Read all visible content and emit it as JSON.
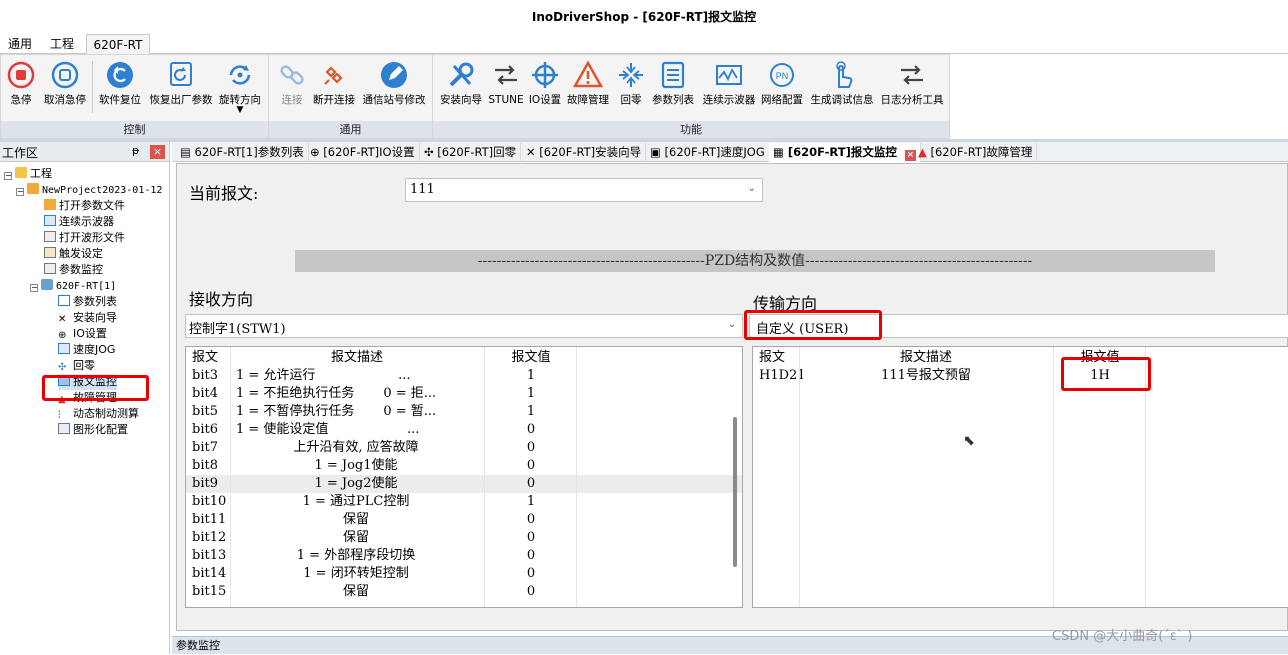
{
  "window": {
    "title": "InoDriverShop - [620F-RT]报文监控"
  },
  "menu_tabs": [
    "通用",
    "工程",
    "620F-RT"
  ],
  "ribbon": {
    "groups": [
      {
        "label": "控制",
        "buttons": [
          "急停",
          "取消急停",
          "软件复位",
          "恢复出厂参数",
          "旋转方向"
        ]
      },
      {
        "label": "通用",
        "buttons": [
          "连接",
          "断开连接",
          "通信站号修改"
        ]
      },
      {
        "label": "功能",
        "buttons": [
          "安装向导",
          "STUNE",
          "IO设置",
          "故障管理",
          "回零",
          "参数列表",
          "连续示波器",
          "网络配置",
          "生成调试信息",
          "日志分析工具"
        ]
      }
    ]
  },
  "workarea": {
    "title": "工作区",
    "pin": "ᵽ",
    "close": "×",
    "tree": [
      "工程",
      "NewProject2023-01-12",
      "打开参数文件",
      "连续示波器",
      "打开波形文件",
      "触发设定",
      "参数监控",
      "620F-RT[1]",
      "参数列表",
      "安装向导",
      "IO设置",
      "速度JOG",
      "回零",
      "报文监控",
      "故障管理",
      "动态制动测算",
      "图形化配置"
    ]
  },
  "doc_tabs": [
    "620F-RT[1]参数列表",
    "[620F-RT]IO设置",
    "[620F-RT]回零",
    "[620F-RT]安装向导",
    "[620F-RT]速度JOG",
    "[620F-RT]报文监控",
    "[620F-RT]故障管理"
  ],
  "monitor": {
    "current_label": "当前报文:",
    "current_value": "111",
    "pzd_header": "------------------------------------------------PZD结构及数值------------------------------------------------",
    "receive": {
      "title": "接收方向",
      "select": "控制字1(STW1)",
      "columns": [
        "报文",
        "报文描述",
        "报文值"
      ],
      "rows": [
        [
          "bit3",
          "1 = 允许运行                    ...",
          "1"
        ],
        [
          "bit4",
          "1 = 不拒绝执行任务       0 = 拒...",
          "1"
        ],
        [
          "bit5",
          "1 = 不暂停执行任务       0 = 暂...",
          "1"
        ],
        [
          "bit6",
          "1 = 使能设定值                   ...",
          "0"
        ],
        [
          "bit7",
          "上升沿有效, 应答故障",
          "0"
        ],
        [
          "bit8",
          "1 = Jog1使能",
          "0"
        ],
        [
          "bit9",
          "1 = Jog2使能",
          "0"
        ],
        [
          "bit10",
          "1 = 通过PLC控制",
          "1"
        ],
        [
          "bit11",
          "保留",
          "0"
        ],
        [
          "bit12",
          "保留",
          "0"
        ],
        [
          "bit13",
          "1 = 外部程序段切换",
          "0"
        ],
        [
          "bit14",
          "1 = 闭环转矩控制",
          "0"
        ],
        [
          "bit15",
          "保留",
          "0"
        ]
      ]
    },
    "transmit": {
      "title": "传输方向",
      "select": "自定义 (USER)",
      "columns": [
        "报文",
        "报文描述",
        "报文值"
      ],
      "rows": [
        [
          "H1D21",
          "111号报文预留",
          "1H"
        ]
      ]
    }
  },
  "bottom_panel": "参数监控",
  "watermark": "CSDN @大小曲奇(´ε` )"
}
